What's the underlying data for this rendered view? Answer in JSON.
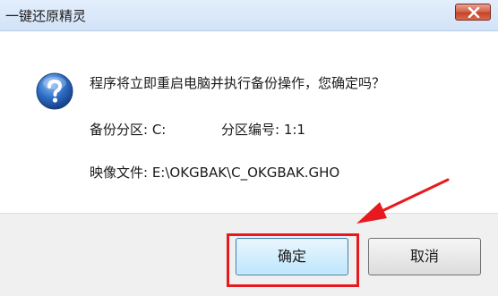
{
  "window": {
    "title": "一键还原精灵"
  },
  "dialog": {
    "icon": "question-icon",
    "message": "程序将立即重启电脑并执行备份操作，您确定吗？",
    "backup_partition": "备份分区: C:",
    "partition_number": "分区编号: 1:1",
    "image_file": "映像文件: E:\\OKGBAK\\C_OKGBAK.GHO"
  },
  "buttons": {
    "ok": "确定",
    "cancel": "取消"
  },
  "colors": {
    "annotation": "#e8191e",
    "titlebar": "#d8e6f8",
    "footer": "#f0f0f0"
  }
}
